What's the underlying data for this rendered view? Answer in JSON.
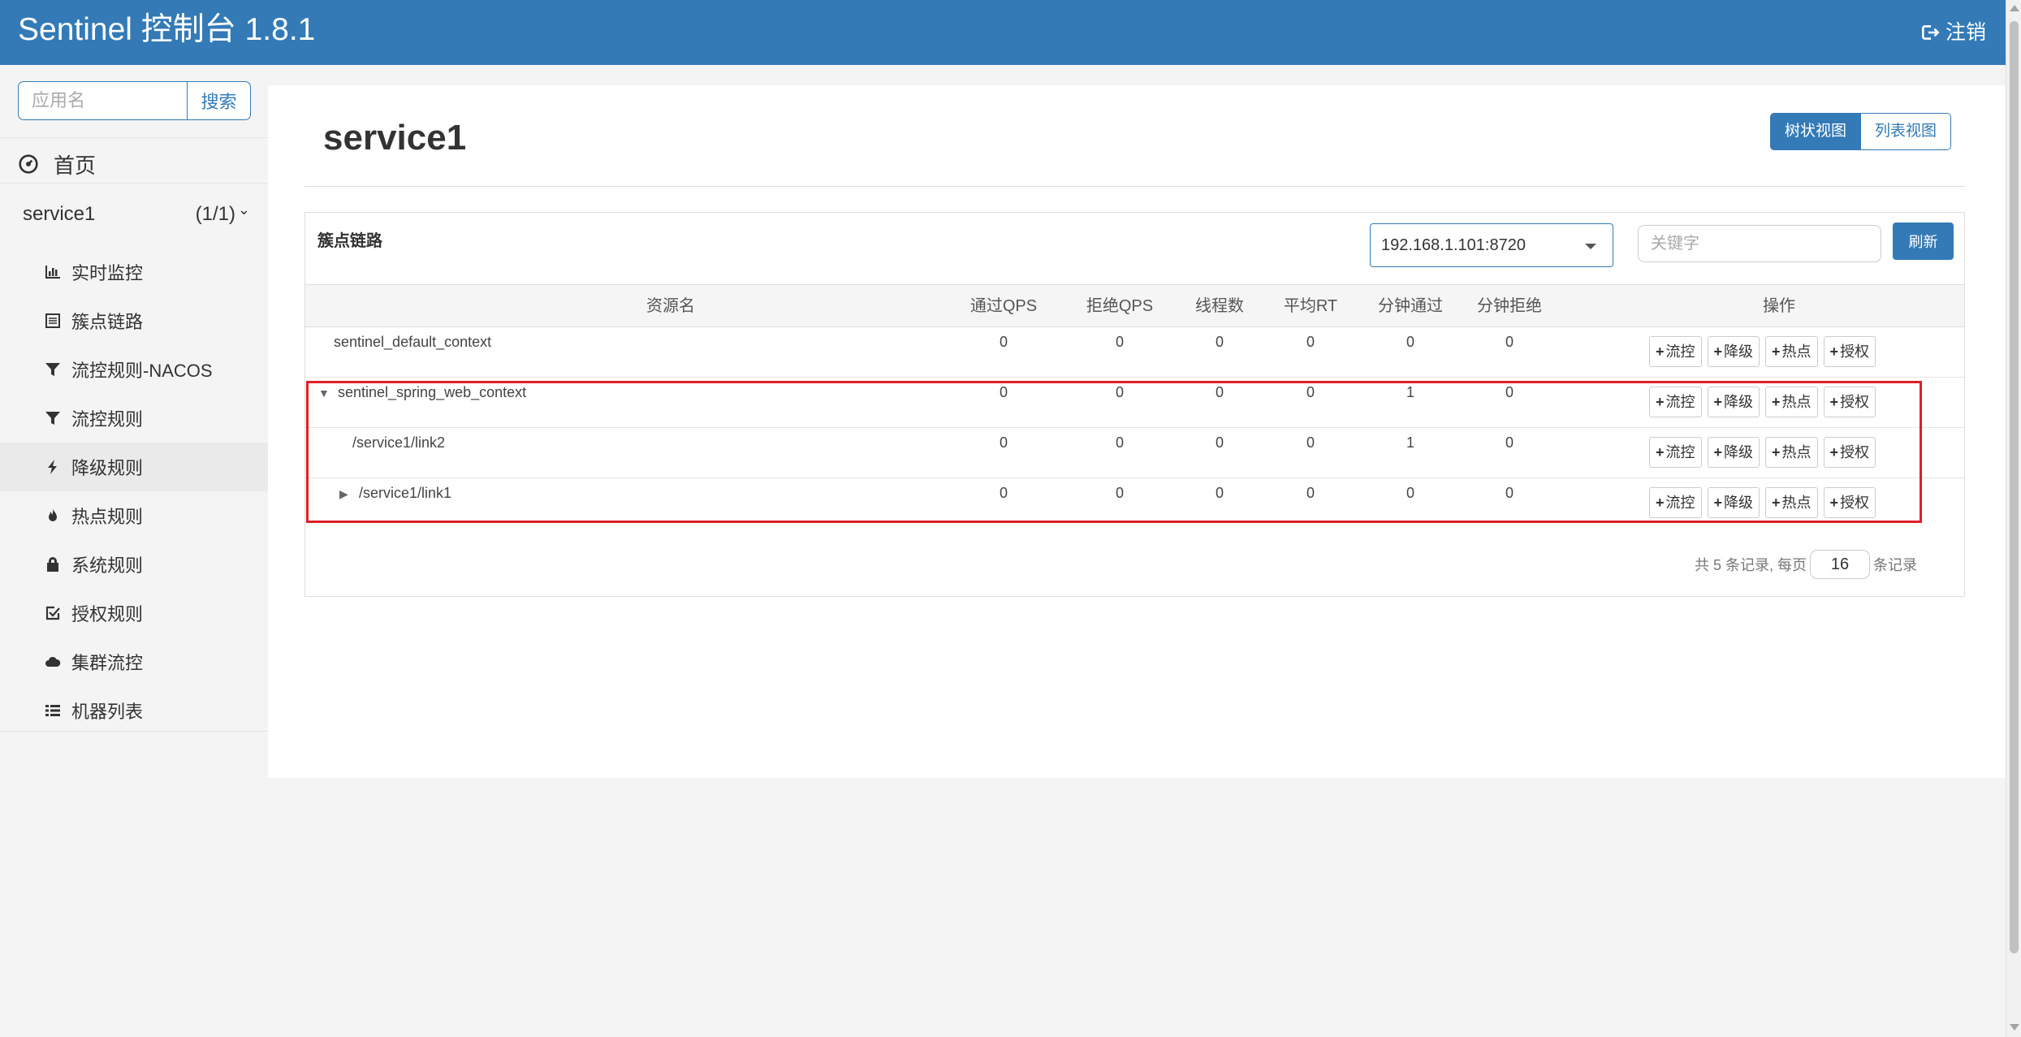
{
  "header": {
    "brand": "Sentinel 控制台 1.8.1",
    "logout_label": "注销"
  },
  "sidebar": {
    "search_placeholder": "应用名",
    "search_button": "搜索",
    "home_label": "首页",
    "app": {
      "name": "service1",
      "count": "(1/1)"
    },
    "items": [
      {
        "label": "实时监控",
        "icon": "bar-chart-icon"
      },
      {
        "label": "簇点链路",
        "icon": "list-alt-icon"
      },
      {
        "label": "流控规则-NACOS",
        "icon": "filter-icon"
      },
      {
        "label": "流控规则",
        "icon": "filter-icon"
      },
      {
        "label": "降级规则",
        "icon": "flash-icon",
        "active": true
      },
      {
        "label": "热点规则",
        "icon": "fire-icon"
      },
      {
        "label": "系统规则",
        "icon": "lock-icon"
      },
      {
        "label": "授权规则",
        "icon": "check-icon"
      },
      {
        "label": "集群流控",
        "icon": "cloud-icon"
      },
      {
        "label": "机器列表",
        "icon": "th-list-icon"
      }
    ]
  },
  "main": {
    "title": "service1",
    "tree_view_label": "树状视图",
    "list_view_label": "列表视图",
    "card_title": "簇点链路",
    "machine": "192.168.1.101:8720",
    "keyword_placeholder": "关键字",
    "refresh_label": "刷新",
    "columns": [
      "资源名",
      "通过QPS",
      "拒绝QPS",
      "线程数",
      "平均RT",
      "分钟通过",
      "分钟拒绝",
      "操作"
    ],
    "op_labels": [
      "流控",
      "降级",
      "热点",
      "授权"
    ],
    "rows": [
      {
        "name": "sentinel_default_context",
        "toggle": "",
        "values": [
          "0",
          "0",
          "0",
          "0",
          "0",
          "0"
        ]
      },
      {
        "name": "sentinel_spring_web_context",
        "toggle": "▼",
        "values": [
          "0",
          "0",
          "0",
          "0",
          "1",
          "0"
        ]
      },
      {
        "name": "/service1/link2",
        "toggle": "",
        "values": [
          "0",
          "0",
          "0",
          "0",
          "1",
          "0"
        ]
      },
      {
        "name": "/service1/link1",
        "toggle": "▶",
        "values": [
          "0",
          "0",
          "0",
          "0",
          "0",
          "0"
        ]
      }
    ],
    "pager": {
      "prefix": "共 5 条记录, 每页",
      "page_size": "16",
      "suffix": "条记录"
    }
  },
  "colors": {
    "primary": "#337ab7",
    "highlight": "#dd1f26"
  }
}
